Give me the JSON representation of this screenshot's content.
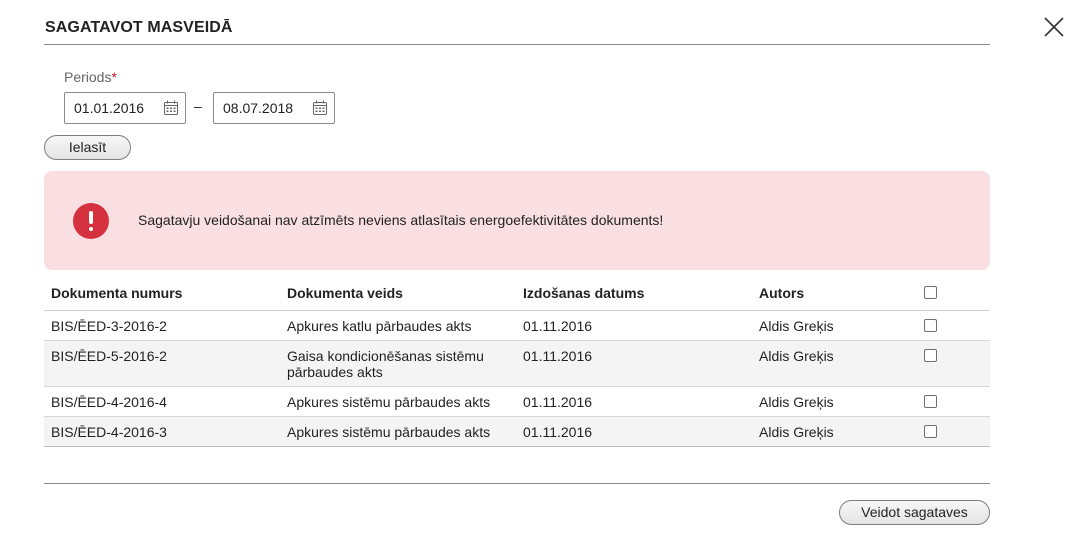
{
  "dialog": {
    "title": "SAGATAVOT MASVEIDĀ",
    "close_icon": "close-icon"
  },
  "period": {
    "label": "Periods",
    "required_mark": "*",
    "from": "01.01.2016",
    "to": "08.07.2018",
    "separator": "–",
    "calendar_icon": "calendar-icon"
  },
  "buttons": {
    "read": "Ielasīt",
    "create": "Veidot sagataves"
  },
  "alert": {
    "icon": "error-exclamation-icon",
    "message": "Sagatavju veidošanai nav atzīmēts neviens atlasītais energoefektivitātes dokuments!"
  },
  "table": {
    "headers": [
      "Dokumenta numurs",
      "Dokumenta veids",
      "Izdošanas datums",
      "Autors"
    ],
    "rows": [
      {
        "number": "BIS/ĒED-3-2016-2",
        "type": "Apkures katlu pārbaudes akts",
        "date": "01.11.2016",
        "author": "Aldis Greķis",
        "checked": false
      },
      {
        "number": "BIS/ĒED-5-2016-2",
        "type": "Gaisa kondicionēšanas sistēmu pārbaudes akts",
        "date": "01.11.2016",
        "author": "Aldis Greķis",
        "checked": false
      },
      {
        "number": "BIS/ĒED-4-2016-4",
        "type": "Apkures sistēmu pārbaudes akts",
        "date": "01.11.2016",
        "author": "Aldis Greķis",
        "checked": false
      },
      {
        "number": "BIS/ĒED-4-2016-3",
        "type": "Apkures sistēmu pārbaudes akts",
        "date": "01.11.2016",
        "author": "Aldis Greķis",
        "checked": false
      }
    ]
  },
  "colors": {
    "alert_background": "#f9dfe2",
    "alert_icon": "#d6313f",
    "required": "#c8102e"
  }
}
